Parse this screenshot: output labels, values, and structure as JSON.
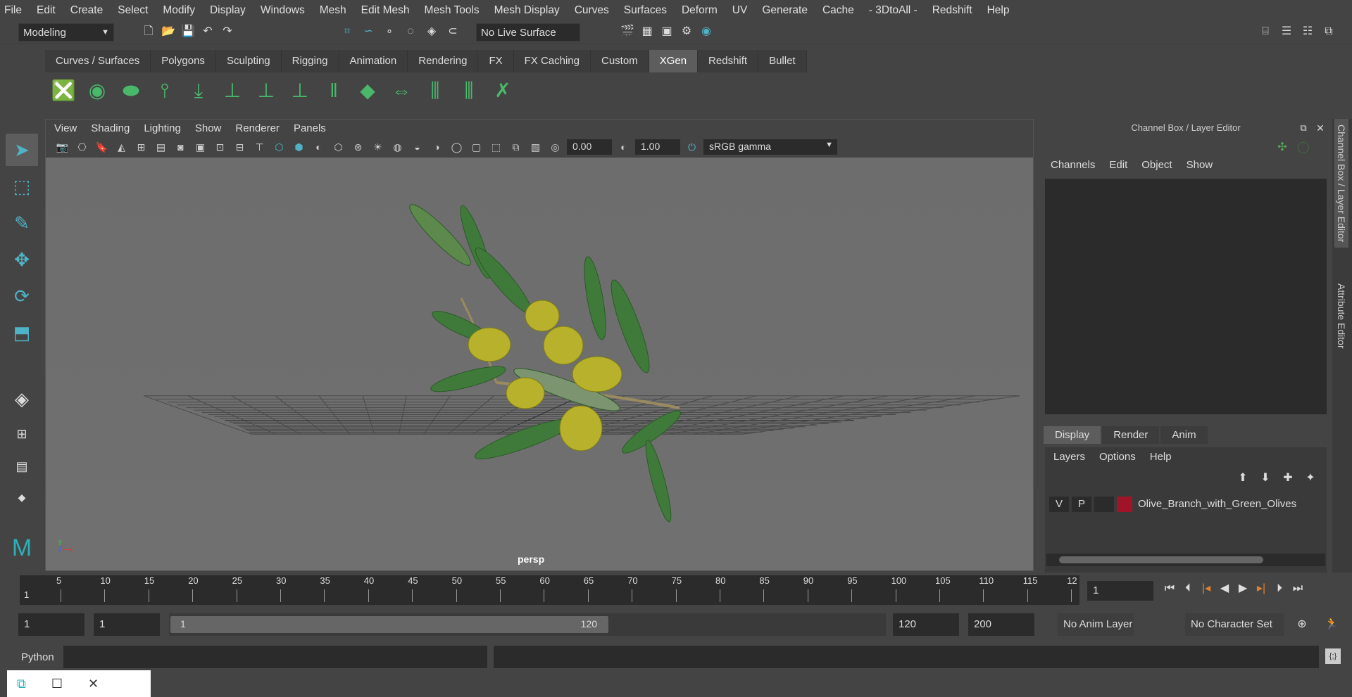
{
  "menu": [
    "File",
    "Edit",
    "Create",
    "Select",
    "Modify",
    "Display",
    "Windows",
    "Mesh",
    "Edit Mesh",
    "Mesh Tools",
    "Mesh Display",
    "Curves",
    "Surfaces",
    "Deform",
    "UV",
    "Generate",
    "Cache",
    "- 3DtoAll -",
    "Redshift",
    "Help"
  ],
  "toolbar": {
    "mode": "Modeling",
    "live_surface": "No Live Surface"
  },
  "shelf_tabs": [
    "Curves / Surfaces",
    "Polygons",
    "Sculpting",
    "Rigging",
    "Animation",
    "Rendering",
    "FX",
    "FX Caching",
    "Custom",
    "XGen",
    "Redshift",
    "Bullet"
  ],
  "active_shelf": "XGen",
  "viewport": {
    "menu": [
      "View",
      "Shading",
      "Lighting",
      "Show",
      "Renderer",
      "Panels"
    ],
    "exposure": "0.00",
    "gamma": "1.00",
    "color_space": "sRGB gamma",
    "camera": "persp"
  },
  "channel_box": {
    "title": "Channel Box / Layer Editor",
    "menu": [
      "Channels",
      "Edit",
      "Object",
      "Show"
    ]
  },
  "layer_editor": {
    "tabs": [
      "Display",
      "Render",
      "Anim"
    ],
    "menu": [
      "Layers",
      "Options",
      "Help"
    ],
    "layer": {
      "v": "V",
      "p": "P",
      "name": "Olive_Branch_with_Green_Olives",
      "color": "#a0142a"
    }
  },
  "side_tabs": [
    "Channel Box / Layer Editor",
    "Attribute Editor"
  ],
  "timeline": {
    "ticks": [
      "5",
      "10",
      "15",
      "20",
      "25",
      "30",
      "35",
      "40",
      "45",
      "50",
      "55",
      "60",
      "65",
      "70",
      "75",
      "80",
      "85",
      "90",
      "95",
      "100",
      "105",
      "110",
      "115",
      "12"
    ],
    "start_label": "1",
    "current_frame": "1"
  },
  "range": {
    "start": "1",
    "inner_start": "1",
    "slider_start": "1",
    "slider_end": "120",
    "end": "120",
    "max": "200",
    "anim_layer": "No Anim Layer",
    "char_set": "No Character Set"
  },
  "command": {
    "label": "Python"
  }
}
